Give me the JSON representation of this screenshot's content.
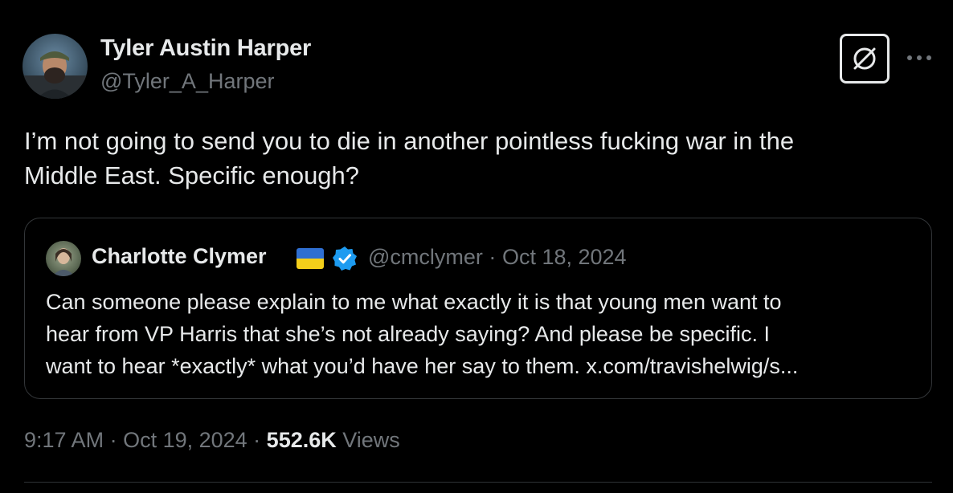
{
  "author": {
    "name": "Tyler Austin Harper",
    "handle": "@Tyler_A_Harper",
    "avatar_icon": "profile-photo"
  },
  "header_actions": {
    "grok_icon": "grok-icon",
    "more_icon": "more-icon"
  },
  "tweet": {
    "text": "I’m not going to send you to die in another pointless fucking war in the\nMiddle East. Specific enough?"
  },
  "quoted": {
    "name": "Charlotte Clymer",
    "flag_icon": "ukraine-flag-icon",
    "verified_icon": "verified-badge-icon",
    "handle": "@cmclymer",
    "separator": "·",
    "date": "Oct 18, 2024",
    "text": "Can someone please explain to me what exactly it is that young men want to\nhear from VP Harris that she’s not already saying? And please be specific. I\nwant to hear *exactly* what you’d have her say to them. x.com/travishelwig/s..."
  },
  "footer": {
    "time": "9:17 AM",
    "separator1": " · ",
    "date": "Oct 19, 2024",
    "separator2": " · ",
    "views_count": "552.6K",
    "views_label": " Views"
  },
  "colors": {
    "background": "#000000",
    "text_primary": "#e7e9ea",
    "text_secondary": "#71767b",
    "border": "#333639",
    "verified": "#1d9bf0",
    "flag_blue": "#2f6fd1",
    "flag_yellow": "#f4cf1a"
  }
}
